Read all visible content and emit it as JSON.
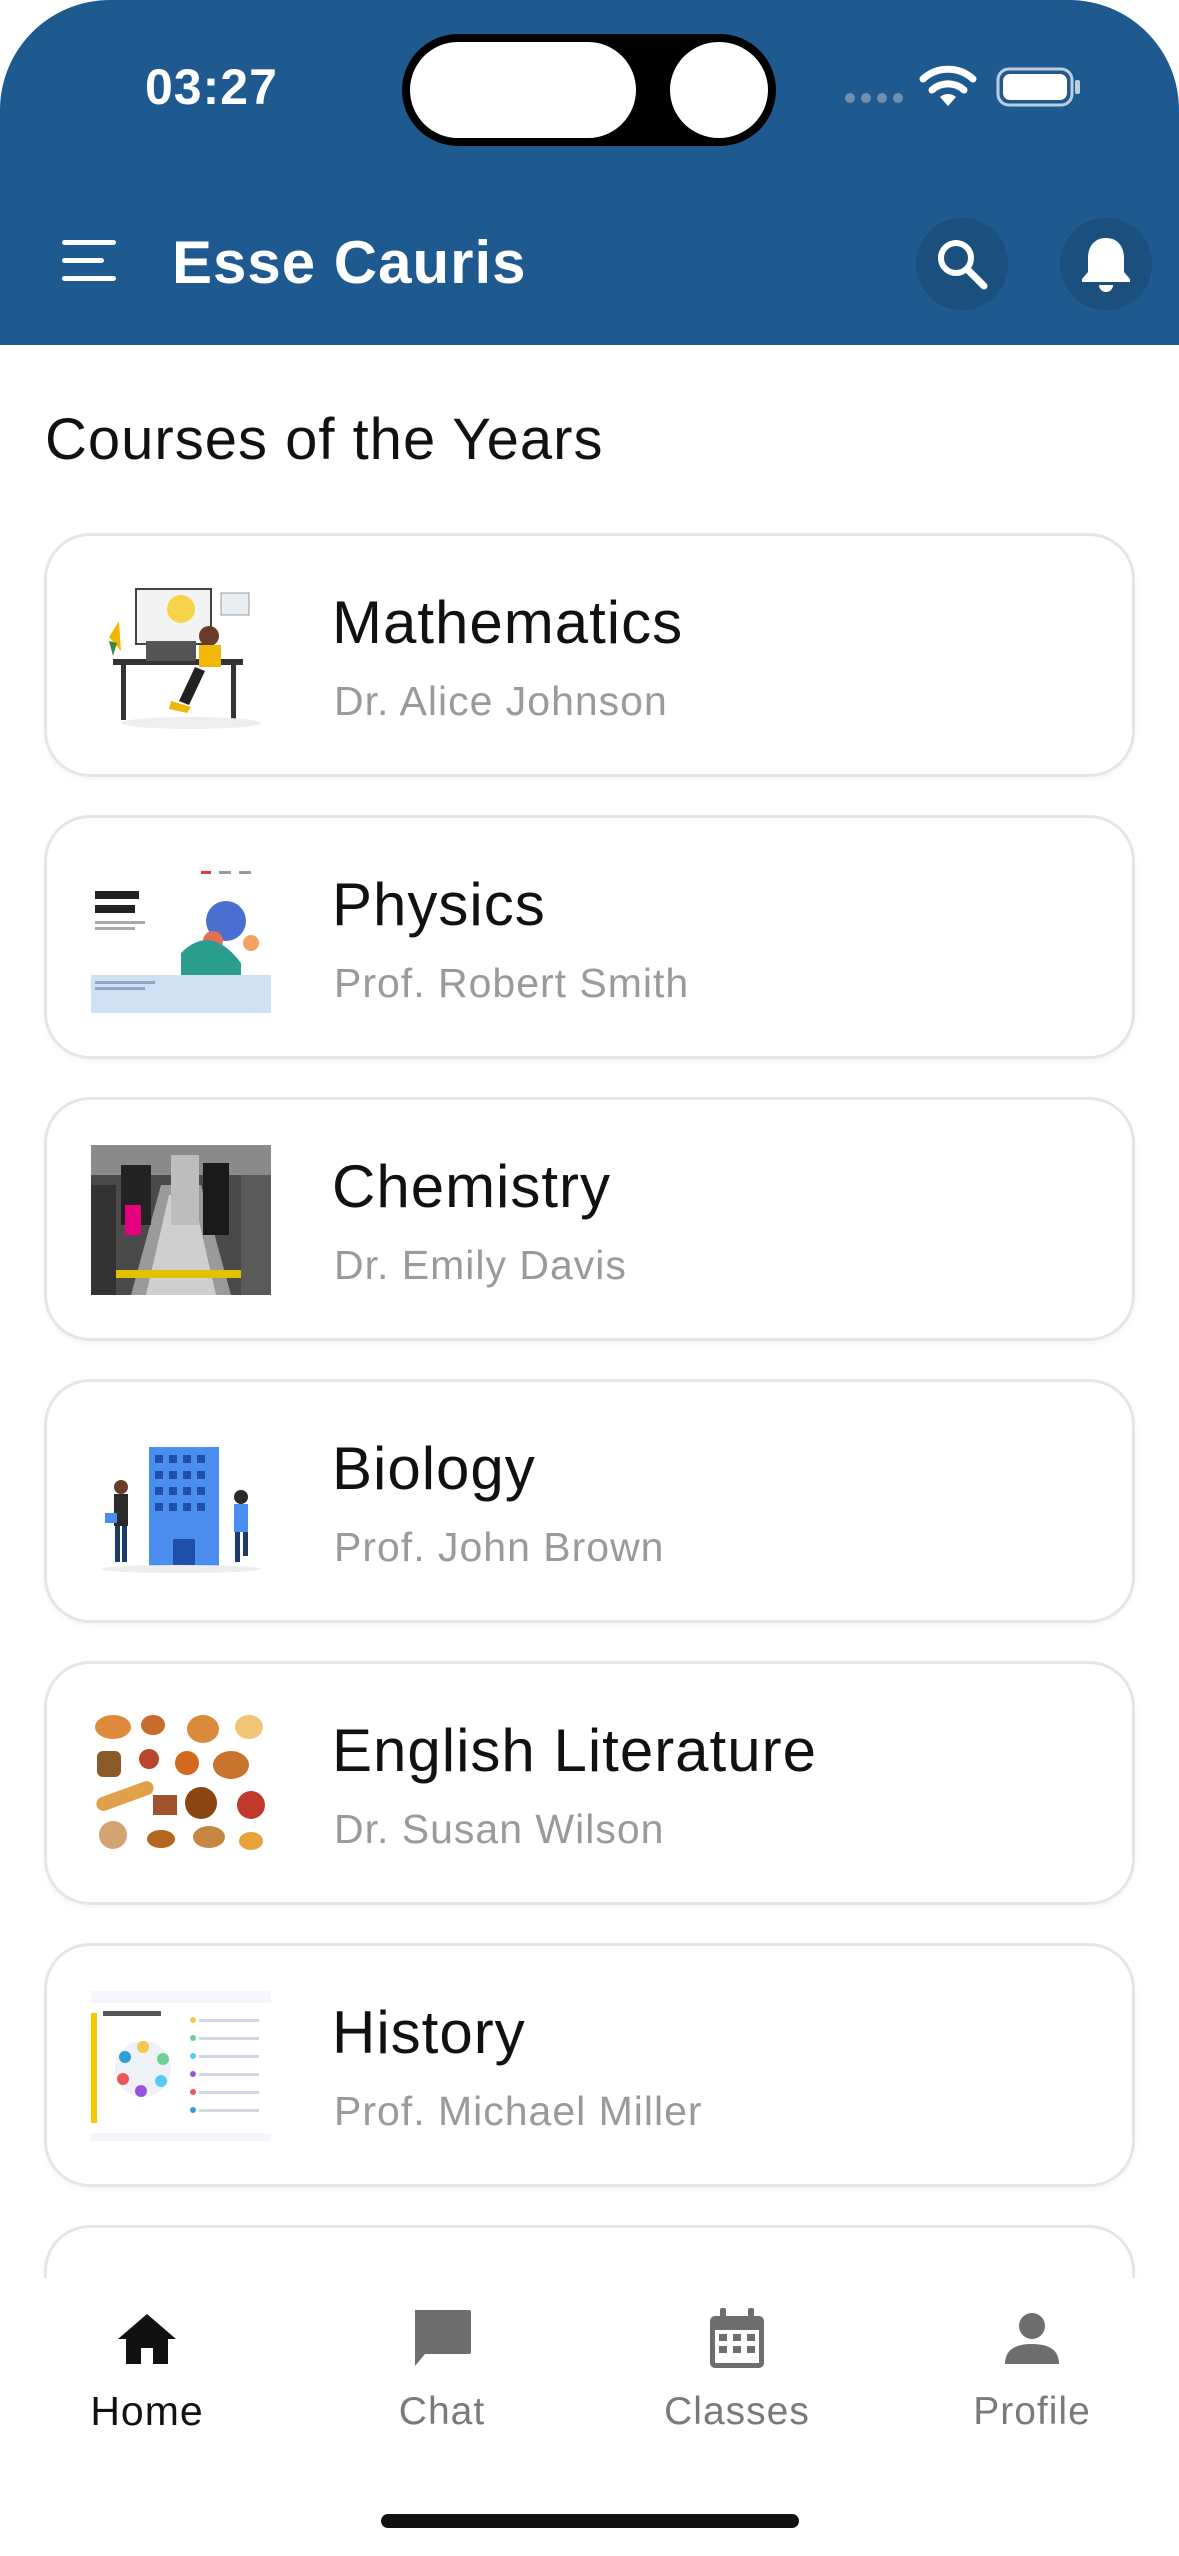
{
  "status_bar": {
    "time": "03:27"
  },
  "app_bar": {
    "title": "Esse Cauris"
  },
  "section_title": "Courses of the Years",
  "courses": [
    {
      "name": "Mathematics",
      "teacher": "Dr. Alice Johnson",
      "thumbnail": "person-at-desk-illustration"
    },
    {
      "name": "Physics",
      "teacher": "Prof. Robert Smith",
      "thumbnail": "website-landing-page-illustration"
    },
    {
      "name": "Chemistry",
      "teacher": "Dr. Emily Davis",
      "thumbnail": "escalator-shoppers-photo"
    },
    {
      "name": "Biology",
      "teacher": "Prof. John Brown",
      "thumbnail": "company-building-illustration"
    },
    {
      "name": "English Literature",
      "teacher": "Dr. Susan Wilson",
      "thumbnail": "bakery-items-illustration"
    },
    {
      "name": "History",
      "teacher": "Prof. Michael Miller",
      "thumbnail": "manufacturing-infographic"
    }
  ],
  "bottom_nav": {
    "items": [
      {
        "label": "Home",
        "icon": "home-icon",
        "active": true
      },
      {
        "label": "Chat",
        "icon": "chat-icon",
        "active": false
      },
      {
        "label": "Classes",
        "icon": "calendar-icon",
        "active": false
      },
      {
        "label": "Profile",
        "icon": "person-icon",
        "active": false
      }
    ]
  },
  "colors": {
    "header_bg": "#1e5a8f",
    "header_button_bg": "#1a4f7e",
    "text_primary": "#111111",
    "text_secondary": "#9a9a9a",
    "nav_inactive": "#7a7a7a"
  }
}
